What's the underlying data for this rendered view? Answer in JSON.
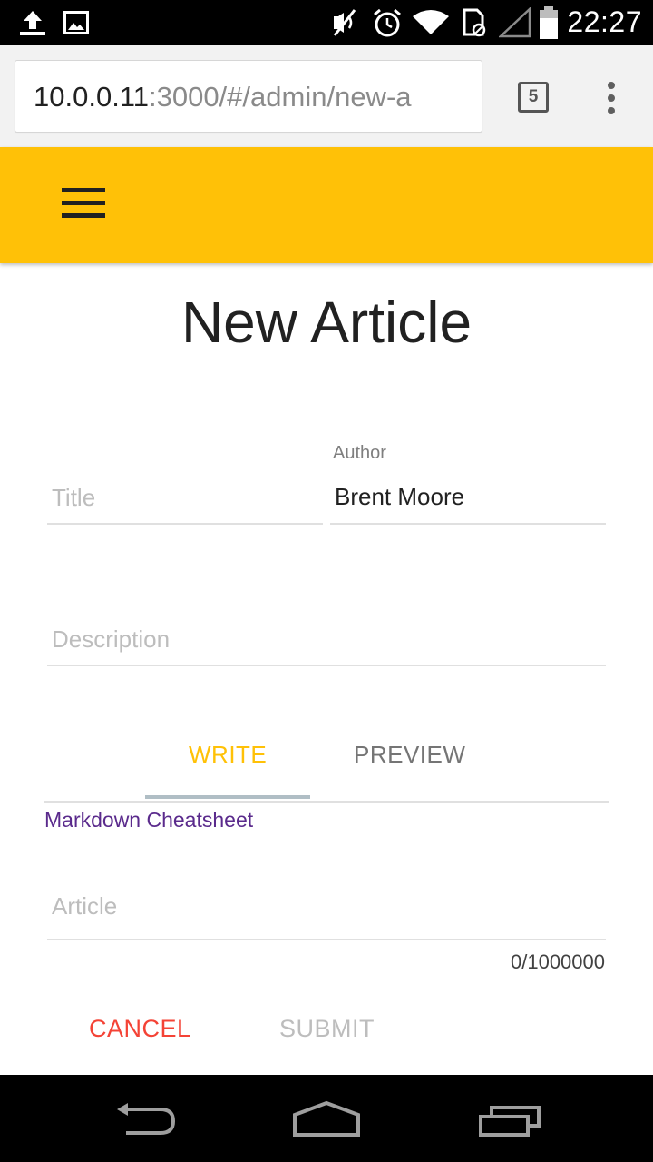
{
  "status_bar": {
    "time": "22:27",
    "icons": [
      "upload-icon",
      "image-icon",
      "mute-icon",
      "alarm-icon",
      "wifi-icon",
      "sim-icon",
      "signal-icon",
      "battery-icon"
    ]
  },
  "browser": {
    "url_host": "10.0.0.11",
    "url_path": ":3000/#/admin/new-a",
    "tab_count": "5"
  },
  "app_bar": {
    "color": "#ffc107"
  },
  "page": {
    "title": "New Article"
  },
  "form": {
    "title_placeholder": "Title",
    "author_label": "Author",
    "author_value": "Brent Moore",
    "description_placeholder": "Description",
    "article_placeholder": "Article",
    "article_counter": "0/1000000"
  },
  "tabs": {
    "write": "WRITE",
    "preview": "PREVIEW",
    "active": "WRITE"
  },
  "links": {
    "cheatsheet": "Markdown Cheatsheet"
  },
  "buttons": {
    "cancel": "CANCEL",
    "submit": "SUBMIT"
  },
  "colors": {
    "accent": "#ffc107",
    "cancel": "#f44336",
    "link": "#5a2a8c"
  }
}
